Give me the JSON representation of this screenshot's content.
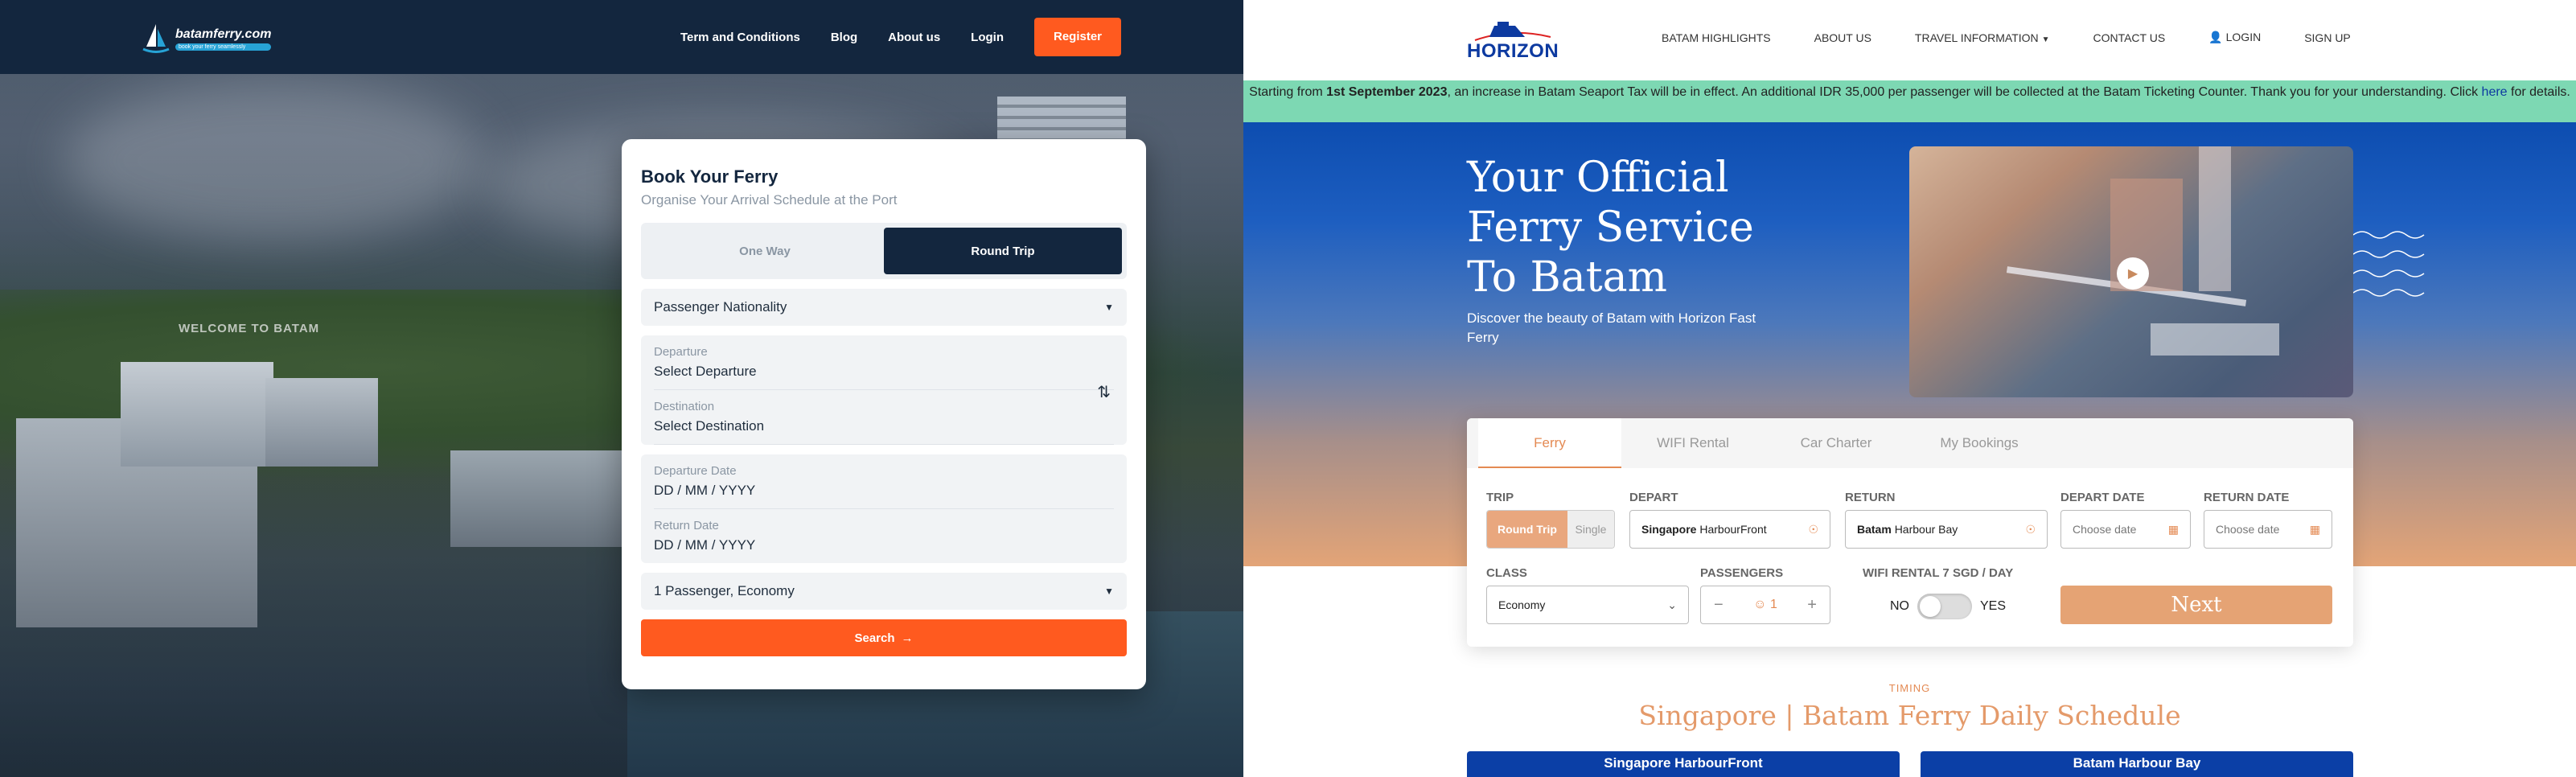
{
  "left": {
    "nav": {
      "logo_name": "batamferry.com",
      "logo_tag": "book your ferry seamlessly",
      "links": [
        "Term and Conditions",
        "Blog",
        "About us",
        "Login"
      ],
      "register": "Register"
    },
    "bg_sign": "WELCOME TO BATAM",
    "form": {
      "title": "Book Your Ferry",
      "subtitle": "Organise Your Arrival Schedule at the Port",
      "trip_options": [
        "One Way",
        "Round Trip"
      ],
      "trip_selected": "Round Trip",
      "nationality": "Passenger Nationality",
      "departure_label": "Departure",
      "departure_value": "Select Departure",
      "destination_label": "Destination",
      "destination_value": "Select Destination",
      "depart_date_label": "Departure Date",
      "depart_date_value": "DD / MM / YYYY",
      "return_date_label": "Return Date",
      "return_date_value": "DD / MM / YYYY",
      "passengers": "1 Passenger, Economy",
      "search": "Search"
    },
    "colors": {
      "nav": "#13263e",
      "accent": "#ff5a1f"
    }
  },
  "right": {
    "nav": {
      "logo": "HORIZON",
      "links": [
        "BATAM HIGHLIGHTS",
        "ABOUT US",
        "TRAVEL INFORMATION",
        "CONTACT US",
        "LOGIN",
        "SIGN UP"
      ]
    },
    "banner": {
      "pre": "Starting from ",
      "bold": "1st September 2023",
      "mid": ", an increase in Batam Seaport Tax will be in effect. An additional IDR 35,000 per passenger will be collected at the Batam Ticketing Counter. Thank you for your understanding. Click ",
      "link": "here",
      "post": " for details."
    },
    "hero": {
      "title": "Your Official Ferry Service To Batam",
      "subtitle": "Discover the beauty of Batam with Horizon Fast Ferry"
    },
    "booking": {
      "tabs": [
        "Ferry",
        "WIFI Rental",
        "Car Charter",
        "My Bookings"
      ],
      "trip_label": "TRIP",
      "trip_options": [
        "Round Trip",
        "Single"
      ],
      "depart_label": "DEPART",
      "depart_city": "Singapore",
      "depart_port": "HarbourFront",
      "return_label": "RETURN",
      "return_city": "Batam",
      "return_port": "Harbour Bay",
      "depart_date_label": "DEPART DATE",
      "return_date_label": "RETURN DATE",
      "date_placeholder": "Choose date",
      "class_label": "CLASS",
      "class_value": "Economy",
      "passengers_label": "PASSENGERS",
      "passengers_value": "1",
      "wifi_label": "WIFI RENTAL 7 SGD / DAY",
      "wifi_no": "NO",
      "wifi_yes": "YES",
      "next": "Next"
    },
    "schedule": {
      "tag": "TIMING",
      "title": "Singapore | Batam Ferry Daily Schedule",
      "columns": [
        "Singapore HarbourFront",
        "Batam Harbour Bay"
      ]
    },
    "colors": {
      "brand": "#0d3aa0",
      "accent": "#e48a53",
      "banner": "#7dd8b3"
    }
  }
}
